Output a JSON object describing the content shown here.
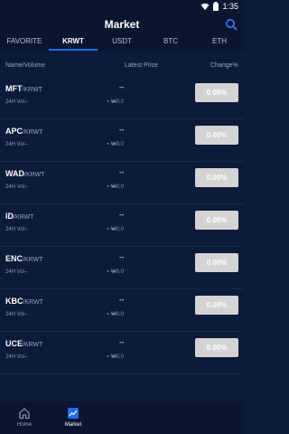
{
  "status": {
    "time": "1:35",
    "icons": [
      "wifi-icon",
      "battery-icon"
    ]
  },
  "header": {
    "title": "Market",
    "search_icon": "search-icon"
  },
  "tabs": [
    {
      "label": "FAVORITE"
    },
    {
      "label": "KRWT",
      "active": true
    },
    {
      "label": "USDT"
    },
    {
      "label": "BTC"
    },
    {
      "label": "ETH"
    }
  ],
  "columns": {
    "name": "Name/Volume",
    "price": "Latest Price",
    "change": "Change%"
  },
  "rows": [
    {
      "base": "MFT",
      "quote": "/KRWT",
      "vol": "24H Vol--",
      "price": "--",
      "krw": "≈ ₩0.0",
      "change": "0.00%"
    },
    {
      "base": "APC",
      "quote": "/KRWT",
      "vol": "24H Vol--",
      "price": "--",
      "krw": "≈ ₩0.0",
      "change": "0.00%"
    },
    {
      "base": "WAD",
      "quote": "/KRWT",
      "vol": "24H Vol--",
      "price": "--",
      "krw": "≈ ₩0.0",
      "change": "0.00%"
    },
    {
      "base": "ID",
      "quote": "/KRWT",
      "vol": "24H Vol--",
      "price": "--",
      "krw": "≈ ₩0.0",
      "change": "0.00%"
    },
    {
      "base": "ENC",
      "quote": "/KRWT",
      "vol": "24H Vol--",
      "price": "--",
      "krw": "≈ ₩0.0",
      "change": "0.00%"
    },
    {
      "base": "KBC",
      "quote": "/KRWT",
      "vol": "24H Vol--",
      "price": "--",
      "krw": "≈ ₩0.0",
      "change": "0.00%"
    },
    {
      "base": "UCE",
      "quote": "/KRWT",
      "vol": "24H Vol--",
      "price": "--",
      "krw": "≈ ₩0.0",
      "change": "0.00%"
    }
  ],
  "nav": [
    {
      "label": "Home",
      "icon": "home-icon"
    },
    {
      "label": "Market",
      "icon": "market-chart-icon",
      "active": true
    },
    {
      "label": "",
      "icon": ""
    },
    {
      "label": "",
      "icon": ""
    },
    {
      "label": "",
      "icon": ""
    }
  ],
  "colors": {
    "background": "#0c1b3a",
    "accent": "#1e6df2",
    "change_badge": "#d3d3d3"
  }
}
